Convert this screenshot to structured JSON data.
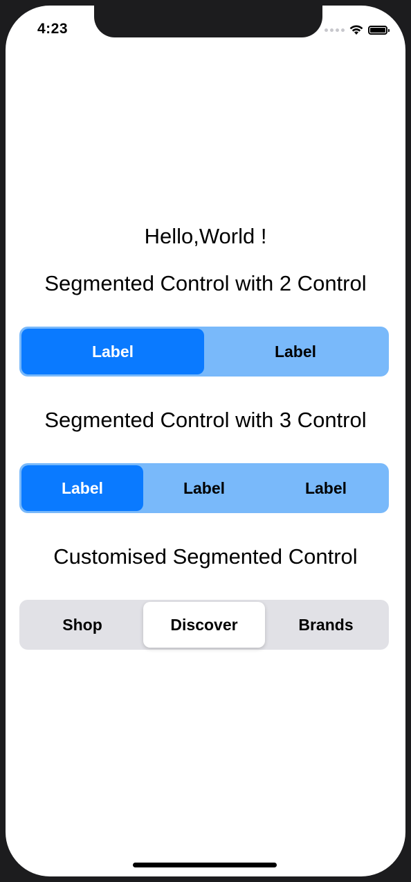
{
  "status_bar": {
    "time": "4:23"
  },
  "headings": {
    "hello": "Hello,World !",
    "seg2": "Segmented Control with 2 Control",
    "seg3": "Segmented Control with 3 Control",
    "custom": "Customised Segmented Control"
  },
  "segmented_2": {
    "selected_index": 0,
    "segments": [
      {
        "label": "Label"
      },
      {
        "label": "Label"
      }
    ]
  },
  "segmented_3": {
    "selected_index": 0,
    "segments": [
      {
        "label": "Label"
      },
      {
        "label": "Label"
      },
      {
        "label": "Label"
      }
    ]
  },
  "segmented_custom": {
    "selected_index": 1,
    "segments": [
      {
        "label": "Shop"
      },
      {
        "label": "Discover"
      },
      {
        "label": "Brands"
      }
    ]
  },
  "colors": {
    "accent": "#0a7aff",
    "segment_track_blue": "#79b9fa",
    "segment_track_gray": "#e1e1e6",
    "background": "#ffffff"
  },
  "icons": {
    "signal": "cellular-signal-icon",
    "wifi": "wifi-icon",
    "battery": "battery-icon"
  }
}
